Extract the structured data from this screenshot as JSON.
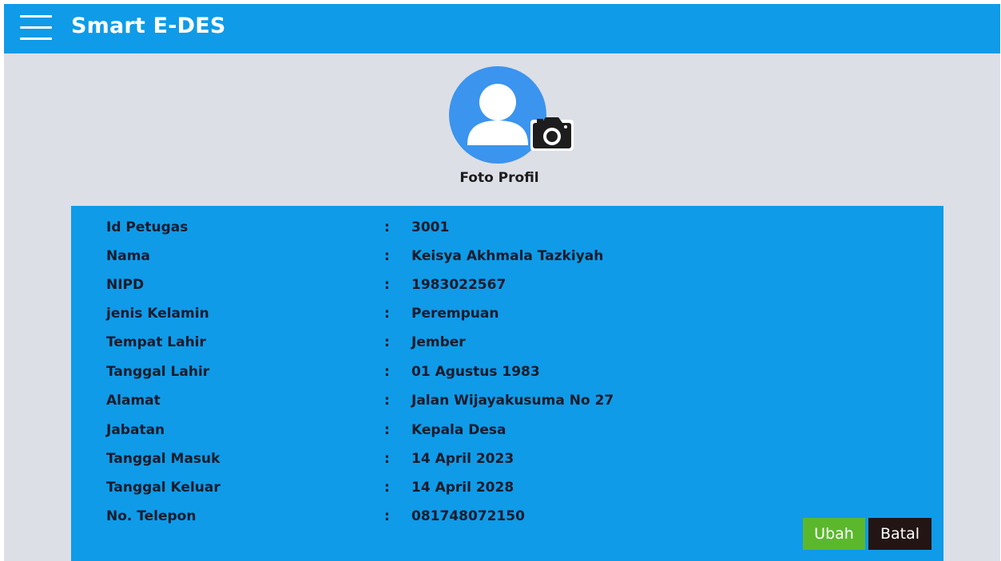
{
  "header": {
    "title": "Smart E-DES",
    "menu_icon": "hamburger-menu-icon",
    "background_color": "#0f9be8"
  },
  "profile": {
    "avatar_icon": "user-avatar-icon",
    "camera_icon": "camera-icon",
    "label": "Foto Profil"
  },
  "details": {
    "separator": ":",
    "rows": [
      {
        "label": "Id Petugas",
        "value": "3001"
      },
      {
        "label": "Nama",
        "value": "Keisya Akhmala Tazkiyah"
      },
      {
        "label": "NIPD",
        "value": "1983022567"
      },
      {
        "label": "jenis Kelamin",
        "value": "Perempuan"
      },
      {
        "label": "Tempat Lahir",
        "value": "Jember"
      },
      {
        "label": "Tanggal Lahir",
        "value": "01 Agustus 1983"
      },
      {
        "label": "Alamat",
        "value": "Jalan Wijayakusuma No 27"
      },
      {
        "label": "Jabatan",
        "value": "Kepala Desa"
      },
      {
        "label": "Tanggal Masuk",
        "value": "14 April 2023"
      },
      {
        "label": "Tanggal Keluar",
        "value": "14 April 2028"
      },
      {
        "label": "No. Telepon",
        "value": "081748072150"
      }
    ]
  },
  "actions": {
    "ubah_label": "Ubah",
    "batal_label": "Batal",
    "ubah_color": "#5bb82d",
    "batal_color": "#221514"
  }
}
